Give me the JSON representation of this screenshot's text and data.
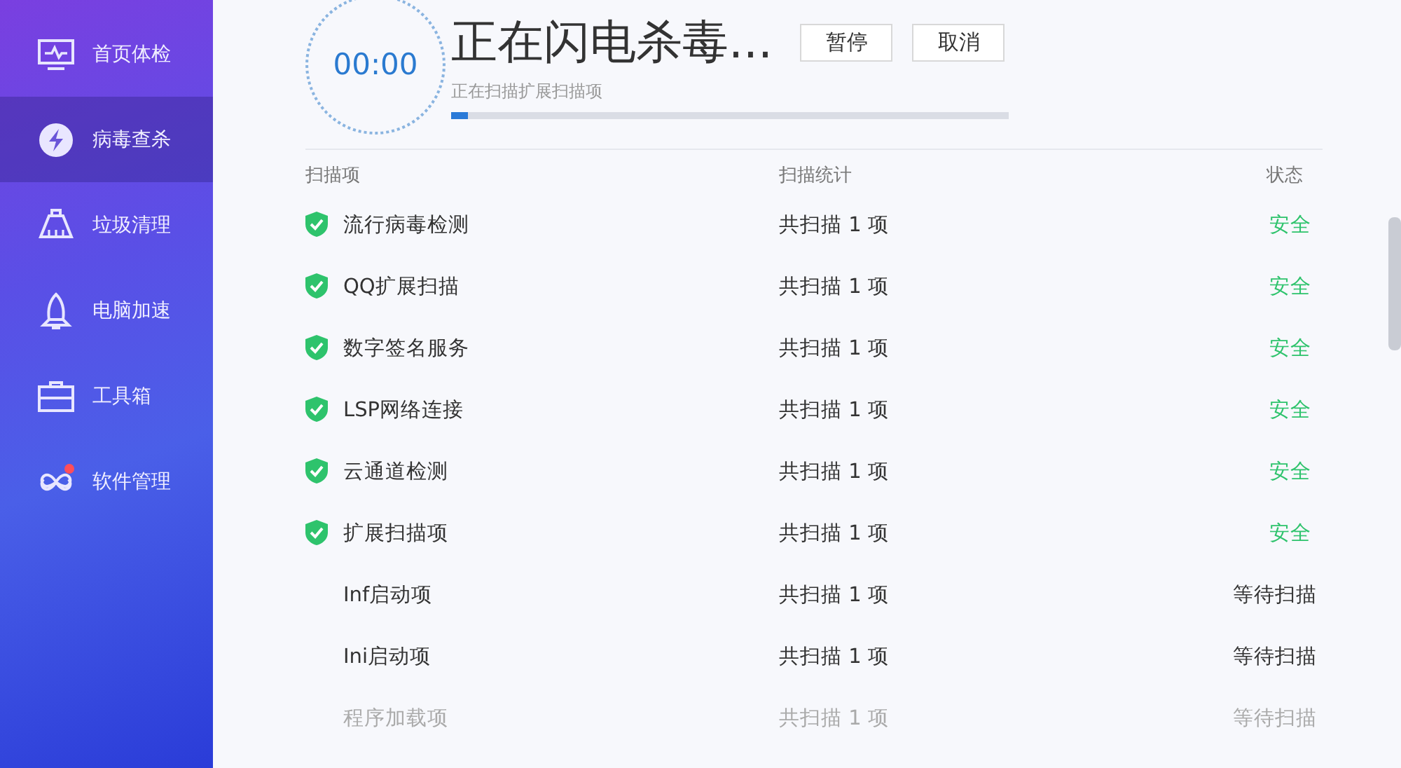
{
  "sidebar": {
    "items": [
      {
        "label": "首页体检",
        "selected": false,
        "badge": false
      },
      {
        "label": "病毒查杀",
        "selected": true,
        "badge": false
      },
      {
        "label": "垃圾清理",
        "selected": false,
        "badge": false
      },
      {
        "label": "电脑加速",
        "selected": false,
        "badge": false
      },
      {
        "label": "工具箱",
        "selected": false,
        "badge": false
      },
      {
        "label": "软件管理",
        "selected": false,
        "badge": true
      }
    ]
  },
  "scan": {
    "timer": "00:00",
    "title": "正在闪电杀毒...",
    "subtitle": "正在扫描扩展扫描项",
    "level": 0.03,
    "buttons": [
      "暂停",
      "取消"
    ]
  },
  "table": {
    "columns": [
      "扫描项",
      "扫描统计",
      "状态"
    ],
    "rows": [
      {
        "name": "流行病毒检测",
        "stats": "共扫描 1 项",
        "status": "安全",
        "kind": "safe"
      },
      {
        "name": "QQ扩展扫描",
        "stats": "共扫描 1 项",
        "status": "安全",
        "kind": "safe"
      },
      {
        "name": "数字签名服务",
        "stats": "共扫描 1 项",
        "status": "安全",
        "kind": "safe"
      },
      {
        "name": "LSP网络连接",
        "stats": "共扫描 1 项",
        "status": "安全",
        "kind": "safe"
      },
      {
        "name": "云通道检测",
        "stats": "共扫描 1 项",
        "status": "安全",
        "kind": "safe"
      },
      {
        "name": "扩展扫描项",
        "stats": "共扫描 1 项",
        "status": "安全",
        "kind": "safe"
      },
      {
        "name": "Inf启动项",
        "stats": "共扫描 1 项",
        "status": "等待扫描",
        "kind": "waiting"
      },
      {
        "name": "Ini启动项",
        "stats": "共扫描 1 项",
        "status": "等待扫描",
        "kind": "waiting"
      },
      {
        "name": "程序加载项",
        "stats": "共扫描 1 项",
        "status": "等待扫描",
        "kind": "waiting"
      }
    ]
  }
}
